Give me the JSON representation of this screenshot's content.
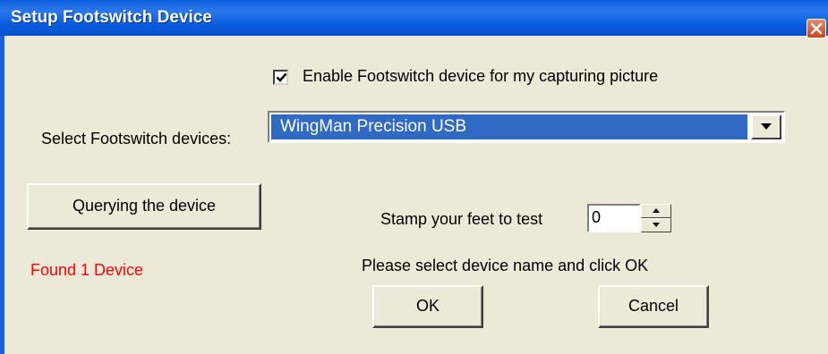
{
  "window": {
    "title": "Setup Footswitch Device",
    "close_icon": "close-x-icon",
    "close_color": "#d9562f",
    "title_color": "#0b5fe0"
  },
  "enable": {
    "checked": true,
    "label": "Enable Footswitch device for my capturing picture"
  },
  "device_select": {
    "label": "Select Footswitch devices:",
    "selected": "WingMan Precision USB",
    "highlight_color": "#316ac5"
  },
  "query_button": {
    "label": "Querying the device"
  },
  "stamp": {
    "label": "Stamp your feet to test",
    "value": "0"
  },
  "status": {
    "text": "Found 1 Device",
    "color": "#ff0000"
  },
  "instruction": "Please select device name and click OK",
  "buttons": {
    "ok": "OK",
    "cancel": "Cancel"
  }
}
